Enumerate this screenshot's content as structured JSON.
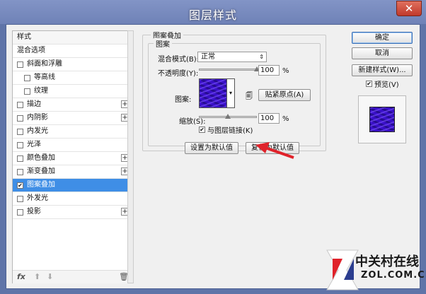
{
  "window": {
    "title": "图层样式",
    "close_glyph": "✕"
  },
  "style_list": {
    "header": "样式",
    "items": [
      {
        "label": "混合选项",
        "checkbox": false,
        "plus": false,
        "indent": 0,
        "checked": false
      },
      {
        "label": "斜面和浮雕",
        "checkbox": true,
        "plus": false,
        "indent": 0,
        "checked": false
      },
      {
        "label": "等高线",
        "checkbox": true,
        "plus": false,
        "indent": 1,
        "checked": false
      },
      {
        "label": "纹理",
        "checkbox": true,
        "plus": false,
        "indent": 1,
        "checked": false
      },
      {
        "label": "描边",
        "checkbox": true,
        "plus": true,
        "indent": 0,
        "checked": false
      },
      {
        "label": "内阴影",
        "checkbox": true,
        "plus": true,
        "indent": 0,
        "checked": false
      },
      {
        "label": "内发光",
        "checkbox": true,
        "plus": false,
        "indent": 0,
        "checked": false
      },
      {
        "label": "光泽",
        "checkbox": true,
        "plus": false,
        "indent": 0,
        "checked": false
      },
      {
        "label": "颜色叠加",
        "checkbox": true,
        "plus": true,
        "indent": 0,
        "checked": false
      },
      {
        "label": "渐变叠加",
        "checkbox": true,
        "plus": true,
        "indent": 0,
        "checked": false
      },
      {
        "label": "图案叠加",
        "checkbox": true,
        "plus": false,
        "indent": 0,
        "checked": true,
        "selected": true
      },
      {
        "label": "外发光",
        "checkbox": true,
        "plus": false,
        "indent": 0,
        "checked": false
      },
      {
        "label": "投影",
        "checkbox": true,
        "plus": true,
        "indent": 0,
        "checked": false
      }
    ],
    "footer": {
      "fx": "fx",
      "up": "⬆",
      "down": "⬇",
      "trash": "🗑"
    }
  },
  "panel": {
    "group_title": "图案叠加",
    "subgroup_title": "图案",
    "blend_label": "混合模式(B):",
    "blend_value": "正常",
    "opacity_label": "不透明度(Y):",
    "opacity_value": "100",
    "opacity_unit": "%",
    "opacity_level": 1.0,
    "pattern_label": "图案:",
    "snap_button": "贴紧原点(A)",
    "scale_label": "缩放(S):",
    "scale_value": "100",
    "scale_unit": "%",
    "scale_level": 0.5,
    "link_label": "与图层链接(K)",
    "link_checked": true,
    "make_default": "设置为默认值",
    "reset_default": "复位为默认值"
  },
  "right": {
    "ok": "确定",
    "cancel": "取消",
    "new_style": "新建样式(W)...",
    "preview_label": "预览(V)",
    "preview_checked": true
  },
  "watermark": {
    "cn": "中关村在线",
    "en": "ZOL.COM.CN"
  },
  "colors": {
    "accent": "#3f8ee6",
    "pattern": "#3a10c8",
    "arrow": "#e0222a"
  }
}
